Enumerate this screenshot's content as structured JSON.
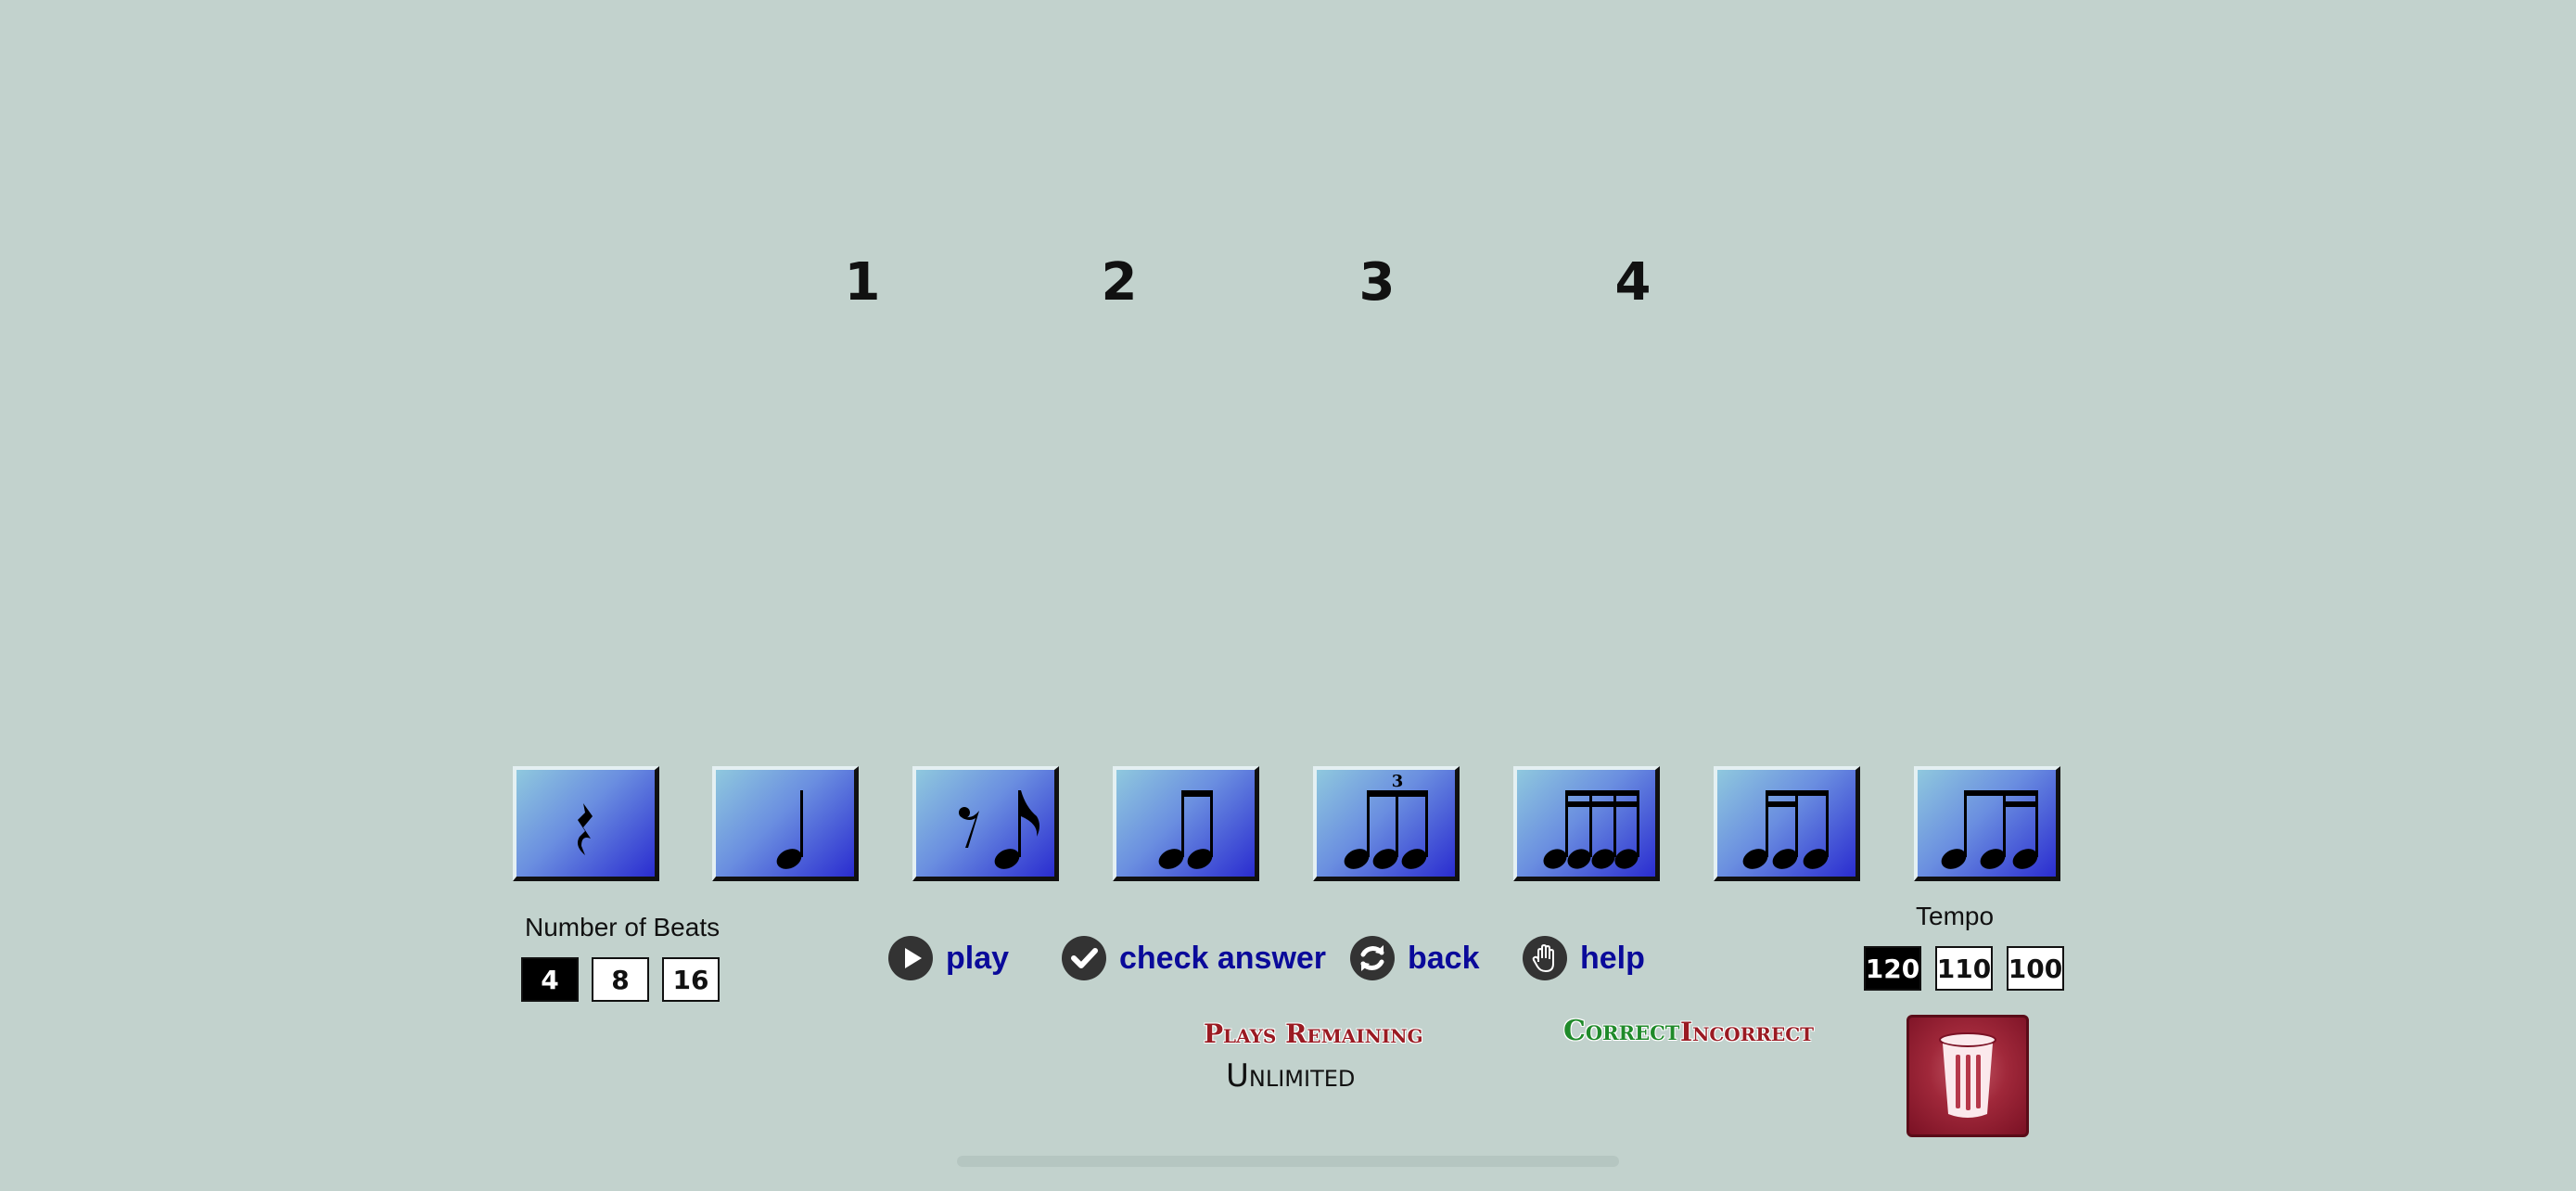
{
  "beat_numbers": [
    "1",
    "2",
    "3",
    "4"
  ],
  "note_palette": [
    {
      "name": "quarter-rest",
      "icon": "quarter-rest-icon"
    },
    {
      "name": "quarter-note",
      "icon": "quarter-note-icon"
    },
    {
      "name": "eighth-rest-eighth-note",
      "icon": "eighth-rest-eighth-note-icon"
    },
    {
      "name": "two-eighth-notes",
      "icon": "two-eighth-notes-icon"
    },
    {
      "name": "eighth-note-triplet",
      "icon": "eighth-note-triplet-icon",
      "tuplet_label": "3"
    },
    {
      "name": "four-sixteenth-notes",
      "icon": "four-sixteenth-notes-icon"
    },
    {
      "name": "two-sixteenths-eighth",
      "icon": "two-sixteenths-eighth-icon"
    },
    {
      "name": "eighth-two-sixteenths",
      "icon": "eighth-two-sixteenths-icon"
    }
  ],
  "beats": {
    "label": "Number of Beats",
    "options": [
      "4",
      "8",
      "16"
    ],
    "selected": "4"
  },
  "tempo": {
    "label": "Tempo",
    "options": [
      "120",
      "110",
      "100"
    ],
    "selected": "120"
  },
  "controls": {
    "play": "play",
    "check_answer": "check answer",
    "back": "back",
    "help": "help"
  },
  "plays": {
    "label": "Plays Remaining",
    "value": "Unlimited"
  },
  "score": {
    "correct": "Correct",
    "incorrect": "Incorrect"
  },
  "colors": {
    "background": "#c2d2cd",
    "control_text": "#0a0a9a",
    "correct": "#1f8a2a",
    "incorrect": "#9a1a22",
    "trash": "#a0283a"
  }
}
